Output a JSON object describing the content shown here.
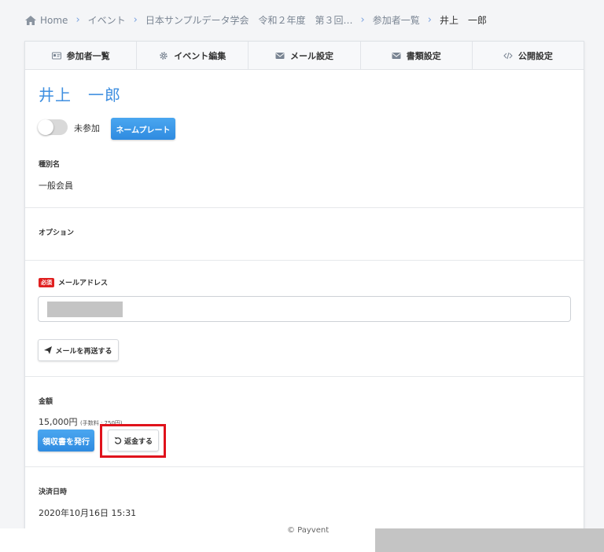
{
  "breadcrumb": {
    "home": "Home",
    "event": "イベント",
    "society": "日本サンプルデータ学会　令和２年度　第３回…",
    "participants": "参加者一覧",
    "current": "井上　一郎"
  },
  "tabs": [
    {
      "label": "参加者一覧",
      "icon": "id-card-icon"
    },
    {
      "label": "イベント編集",
      "icon": "gear-icon"
    },
    {
      "label": "メール設定",
      "icon": "envelope-icon"
    },
    {
      "label": "書類設定",
      "icon": "envelope-icon"
    },
    {
      "label": "公開設定",
      "icon": "code-icon"
    }
  ],
  "participant": {
    "name": "井上　一郎",
    "attendance_status": "未参加",
    "nameplate_button": "ネームプレート"
  },
  "category": {
    "label": "種別名",
    "value": "一般会員"
  },
  "options": {
    "label": "オプション"
  },
  "email": {
    "required_badge": "必須",
    "label": "メールアドレス",
    "resend_button": "メールを再送する"
  },
  "amount": {
    "label": "金額",
    "value": "15,000円",
    "fee": "(手数料 : 750円)",
    "receipt_button": "領収書を発行",
    "refund_button": "返金する"
  },
  "payment": {
    "label": "決済日時",
    "value": "2020年10月16日 15:31"
  },
  "footer": {
    "copyright": "© Payvent"
  },
  "colors": {
    "accent_blue": "#3f8fe0",
    "highlight_red": "#e0121b",
    "required_red": "#e02020"
  }
}
